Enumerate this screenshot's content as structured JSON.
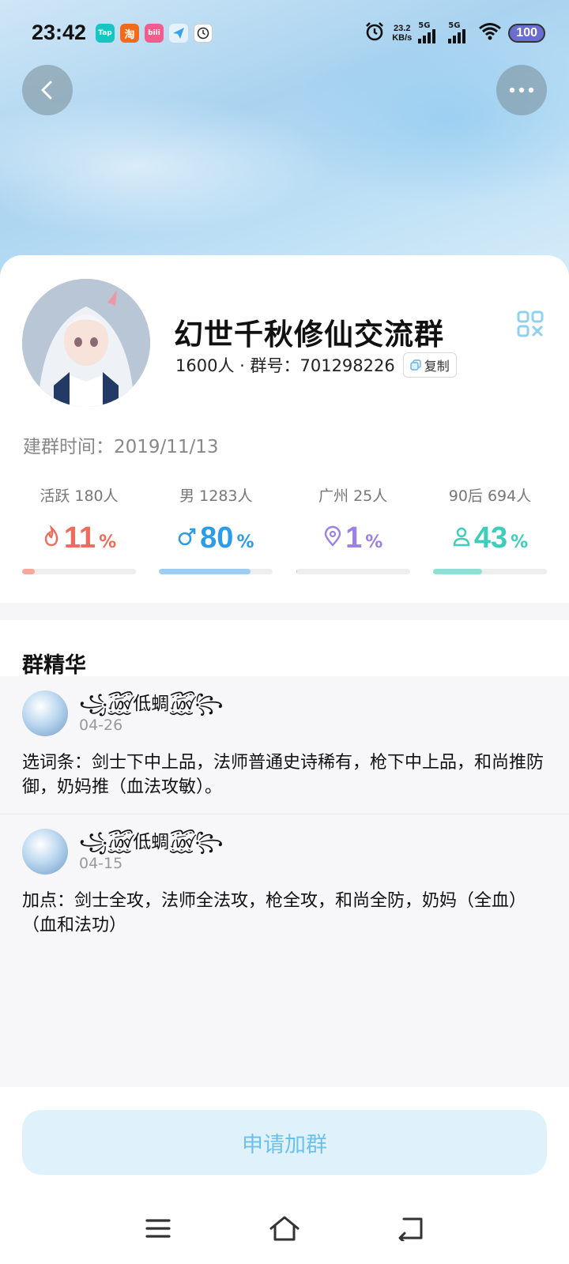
{
  "status_bar": {
    "time": "23:42",
    "app_icons": [
      {
        "name": "taptap-icon",
        "label": "Tap",
        "color": "#16c6c2"
      },
      {
        "name": "taobao-icon",
        "label": "淘",
        "color": "#f26b1d"
      },
      {
        "name": "bilibili-icon",
        "label": "bili",
        "color": "#f25d8e"
      },
      {
        "name": "messenger-icon",
        "label": "",
        "color": "#3aa0f0"
      },
      {
        "name": "clock-app-icon",
        "label": "",
        "color": "#ffffff"
      }
    ],
    "net_speed_value": "23.2",
    "net_speed_unit": "KB/s",
    "signal_1": "5G",
    "signal_2": "5G",
    "battery": "100"
  },
  "group": {
    "name": "幻世千秋修仙交流群",
    "member_count": "1600人",
    "id_label": "群号：",
    "id": "701298226",
    "copy_label": "复制",
    "create_label": "建群时间：",
    "create_date": "2019/11/13"
  },
  "stats": [
    {
      "label": "活跃 180人",
      "icon": "flame-icon",
      "value": "11",
      "unit": "%",
      "percent": 11,
      "color": "#ef6b5b"
    },
    {
      "label": "男 1283人",
      "icon": "male-icon",
      "value": "80",
      "unit": "%",
      "percent": 80,
      "color": "#2e9be6"
    },
    {
      "label": "广州 25人",
      "icon": "location-icon",
      "value": "1",
      "unit": "%",
      "percent": 1,
      "color": "#9b80e6"
    },
    {
      "label": "90后 694人",
      "icon": "person-icon",
      "value": "43",
      "unit": "%",
      "percent": 43,
      "color": "#3fcdbb"
    }
  ],
  "essence": {
    "title": "群精华",
    "posts": [
      {
        "author": "꧁꫞低蜩꫞꧂",
        "date": "04-26",
        "content": "选词条：剑士下中上品，法师普通史诗稀有，枪下中上品，和尚推防御，奶妈推（血法攻敏）。"
      },
      {
        "author": "꧁꫞低蜩꫞꧂",
        "date": "04-15",
        "content": "加点：剑士全攻，法师全法攻，枪全攻，和尚全防，奶妈（全血）（血和法功）"
      }
    ]
  },
  "join_button": "申请加群"
}
